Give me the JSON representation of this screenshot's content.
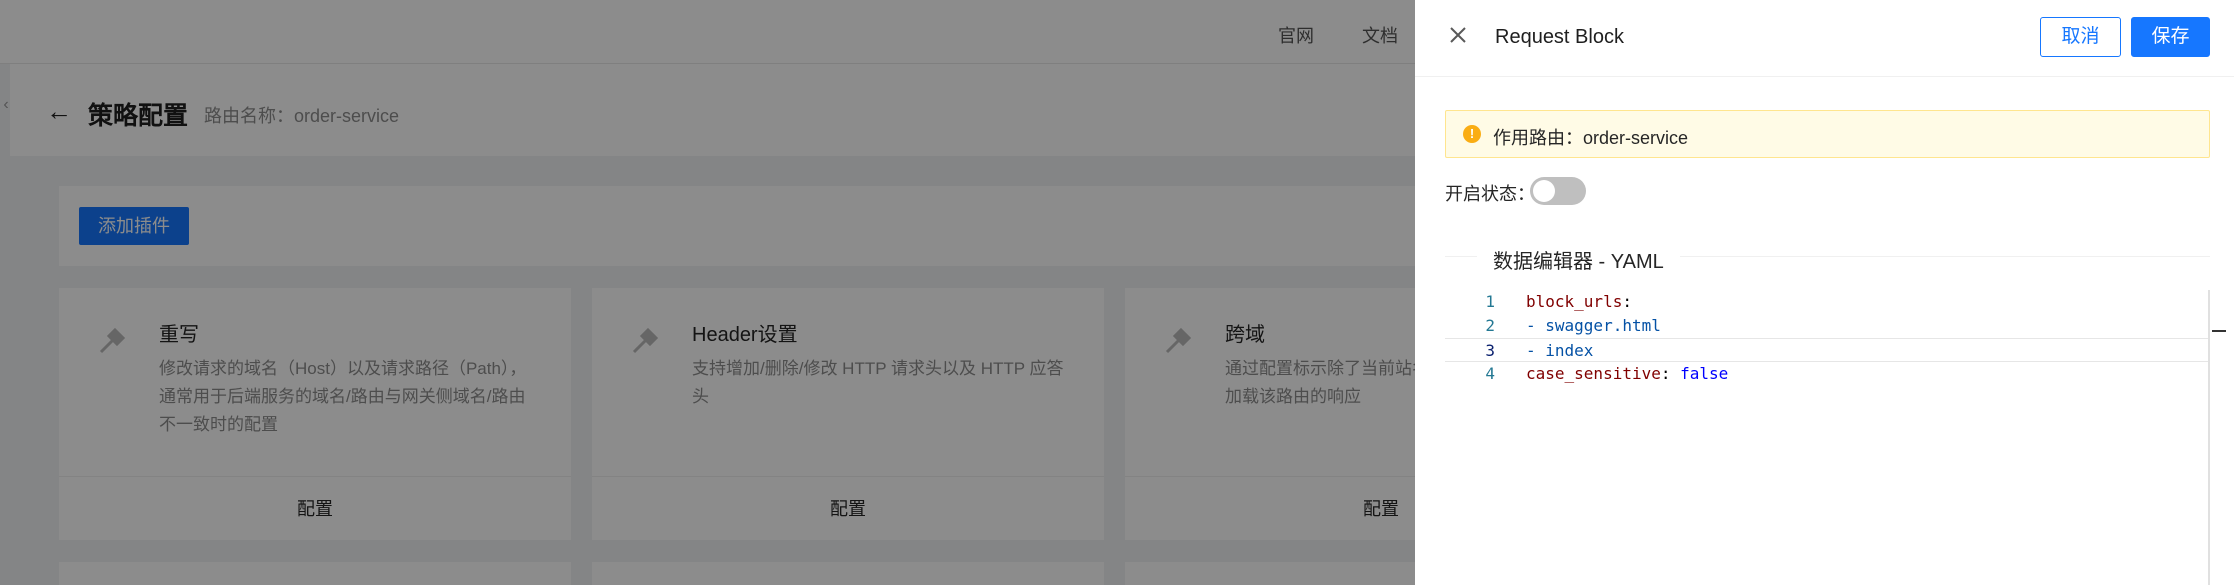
{
  "topbar": {
    "links": [
      "官网",
      "文档"
    ]
  },
  "header": {
    "title": "策略配置",
    "route_label": "路由名称：order-service"
  },
  "toolbar": {
    "add_plugin_label": "添加插件"
  },
  "cards": [
    {
      "title": "重写",
      "description": "修改请求的域名（Host）以及请求路径（Path），通常用于后端服务的域名/路由与网关侧域名/路由不一致时的配置",
      "action": "配置"
    },
    {
      "title": "Header设置",
      "description": "支持增加/删除/修改 HTTP 请求头以及 HTTP 应答头",
      "action": "配置"
    },
    {
      "title": "跨域",
      "description": "通过配置标示除了当前站名、协议或端口），使得加载该路由的响应",
      "action": "配置"
    }
  ],
  "drawer": {
    "title": "Request Block",
    "cancel_label": "取消",
    "save_label": "保存",
    "alert_text": "作用路由：order-service",
    "status_label": "开启状态：",
    "toggle_on": false,
    "section_title": "数据编辑器 - YAML",
    "editor": {
      "lines": [
        {
          "n": "1",
          "text": "block_urls:"
        },
        {
          "n": "2",
          "text": "- swagger.html"
        },
        {
          "n": "3",
          "text": "- index"
        },
        {
          "n": "4",
          "text": "case_sensitive: false"
        }
      ],
      "active_line": 3
    }
  },
  "colors": {
    "primary": "#1677ff",
    "warning": "#faad14",
    "alert_bg": "#fffbe6"
  }
}
